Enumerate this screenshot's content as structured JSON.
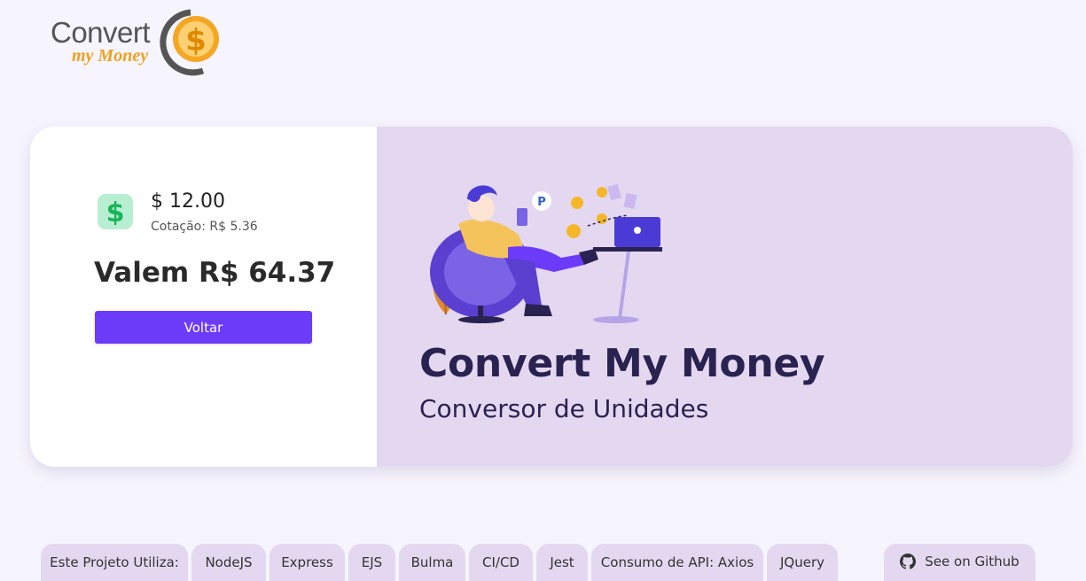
{
  "logo": {
    "word": "Convert",
    "sub": "my Money"
  },
  "conversion": {
    "amount": "$ 12.00",
    "rate": "Cotação: R$ 5.36",
    "result": "Valem R$ 64.37",
    "back_button": "Voltar"
  },
  "brand": {
    "title": "Convert My Money",
    "subtitle": "Conversor de Unidades"
  },
  "tags": [
    "Este Projeto Utiliza:",
    "NodeJS",
    "Express",
    "EJS",
    "Bulma",
    "CI/CD",
    "Jest",
    "Consumo de API: Axios",
    "JQuery"
  ],
  "github": {
    "label": "See on Github",
    "icon": "github-icon"
  },
  "colors": {
    "accent": "#6c3bfa",
    "panel": "#e4d8f1",
    "background": "#f6f4fd",
    "money_icon_bg": "#b8efd2"
  }
}
